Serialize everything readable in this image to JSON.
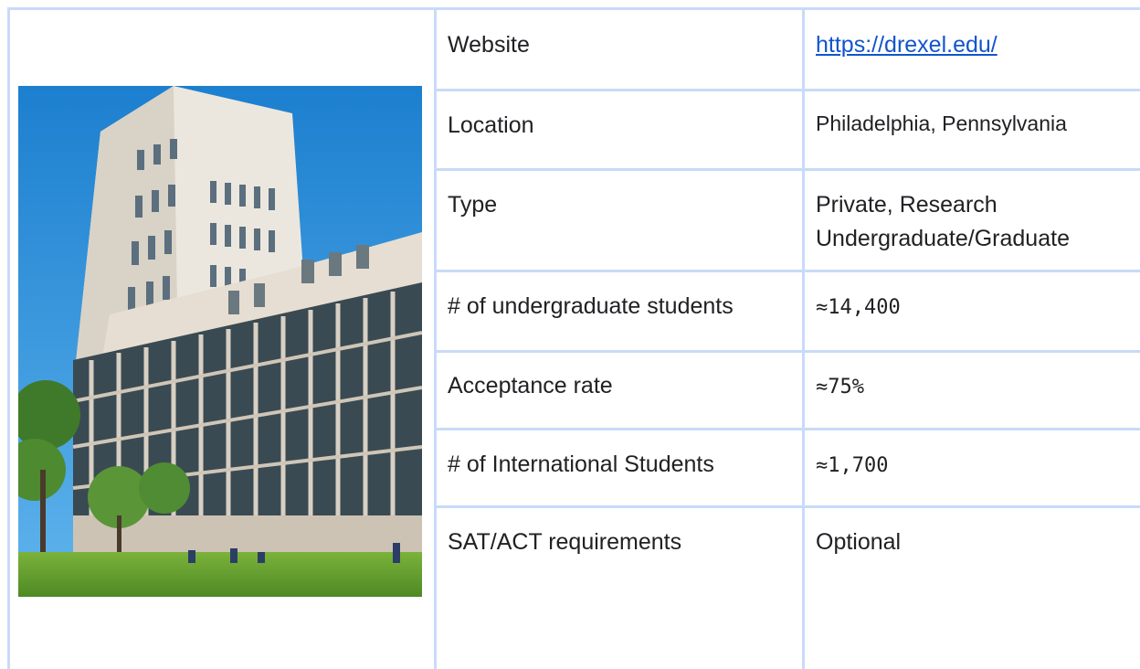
{
  "rows": [
    {
      "label": "Website",
      "value": "https://drexel.edu/"
    },
    {
      "label": "Location",
      "value": "Philadelphia, Pennsylvania"
    },
    {
      "label": "Type",
      "value_line1": "Private, Research",
      "value_line2": "Undergraduate/Graduate"
    },
    {
      "label": "# of undergraduate students",
      "value": "≈14,400"
    },
    {
      "label": "Acceptance rate",
      "value": "≈75%"
    },
    {
      "label": "# of International Students",
      "value": "≈1,700"
    },
    {
      "label": "SAT/ACT requirements",
      "value": "Optional"
    }
  ],
  "colors": {
    "grid": "#c9daf8",
    "link": "#1155cc",
    "sky": "#2f8fd6",
    "grass": "#5f9a2e",
    "building": "#e9e4dc"
  }
}
